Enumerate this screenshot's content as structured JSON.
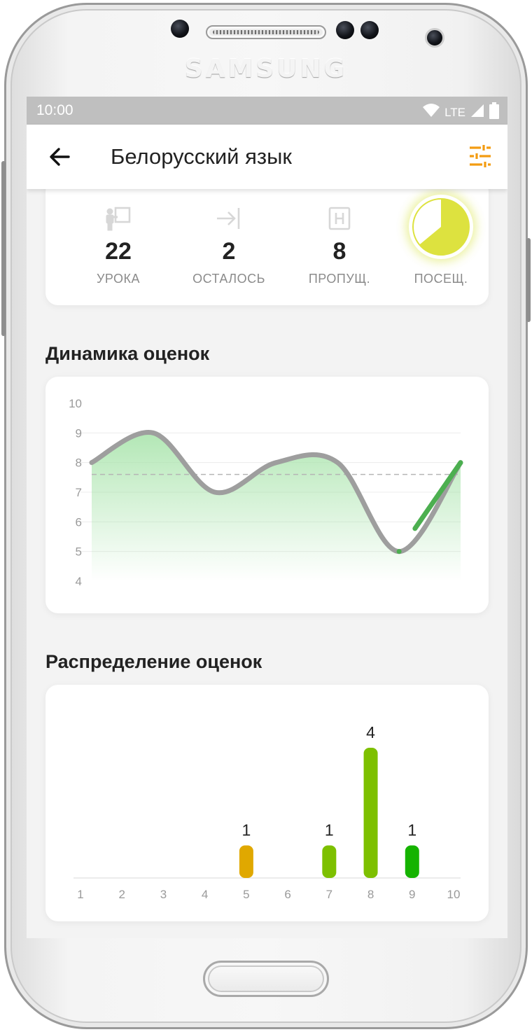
{
  "device": {
    "brand": "SAMSUNG"
  },
  "status_bar": {
    "time": "10:00",
    "network": "LTE"
  },
  "app_bar": {
    "title": "Белорусский язык",
    "back_icon": "arrow-left-icon",
    "filter_icon": "tune-icon",
    "accent": "#F39C12"
  },
  "stats": [
    {
      "icon": "teacher-board-icon",
      "value": "22",
      "label": "УРОКА"
    },
    {
      "icon": "arrow-to-end-icon",
      "value": "2",
      "label": "ОСТАЛОСЬ"
    },
    {
      "icon": "absence-h-icon",
      "value": "8",
      "label": "ПРОПУЩ."
    },
    {
      "icon": "attendance-pie-icon",
      "label": "ПОСЕЩ.",
      "attended_fraction": 0.64,
      "color": "#DDE23F"
    }
  ],
  "dynamics": {
    "title": "Динамика оценок",
    "chart_data": {
      "type": "line",
      "y_ticks": [
        "10",
        "9",
        "8",
        "7",
        "6",
        "5",
        "4"
      ],
      "ylim": [
        4,
        10
      ],
      "values": [
        8,
        9,
        7,
        8,
        8,
        5,
        8
      ],
      "average": 7.6,
      "grid": true,
      "colors": {
        "line": "#9E9E9E",
        "last_segment": "#4CAF50",
        "fill": "#A5E3A8"
      }
    }
  },
  "distribution": {
    "title": "Распределение оценок",
    "chart_data": {
      "type": "bar",
      "categories": [
        "1",
        "2",
        "3",
        "4",
        "5",
        "6",
        "7",
        "8",
        "9",
        "10"
      ],
      "values": [
        0,
        0,
        0,
        0,
        1,
        0,
        1,
        4,
        1,
        0
      ],
      "value_labels": [
        "",
        "",
        "",
        "",
        "1",
        "",
        "1",
        "4",
        "1",
        ""
      ],
      "colors": [
        "#E0A800",
        "#E0A800",
        "#E0A800",
        "#E0A800",
        "#E0A800",
        "#E0A800",
        "#7DC000",
        "#7DC000",
        "#15B300",
        "#15B300"
      ]
    }
  }
}
